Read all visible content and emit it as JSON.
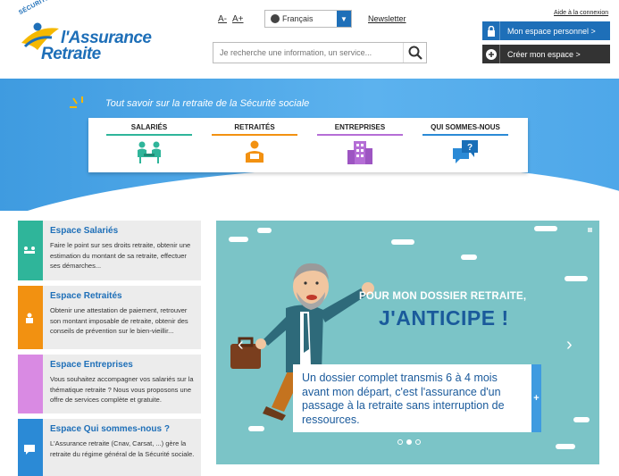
{
  "header": {
    "logo_top": "SÉCURITÉ SOCIALE",
    "logo_line1": "l'Assurance",
    "logo_line2": "Retraite",
    "font_smaller": "A-",
    "font_larger": "A+",
    "language": "Français",
    "newsletter": "Newsletter",
    "search_placeholder": "Je recherche une information, un service...",
    "help_login": "Aide à la connexion",
    "personal_space": "Mon espace personnel >",
    "create_space": "Créer mon espace >"
  },
  "banner": {
    "tagline": "Tout savoir sur la retraite de la Sécurité sociale",
    "categories": [
      {
        "label": "SALARIÉS",
        "color": "#2fb59a",
        "icon": "people-icon"
      },
      {
        "label": "RETRAITÉS",
        "color": "#f29111",
        "icon": "retiree-icon"
      },
      {
        "label": "ENTREPRISES",
        "color": "#b56ed6",
        "icon": "building-icon"
      },
      {
        "label": "QUI SOMMES-NOUS",
        "color": "#2b8ad6",
        "icon": "speech-bubble-icon"
      }
    ]
  },
  "espaces": [
    {
      "title": "Espace Salariés",
      "desc": "Faire le point sur ses droits retraite, obtenir une estimation du montant de sa retraite, effectuer ses démarches...",
      "color": "#2fb59a"
    },
    {
      "title": "Espace Retraités",
      "desc": "Obtenir une attestation de paiement, retrouver son montant imposable de retraite, obtenir des conseils de prévention sur le bien-vieillir...",
      "color": "#f29111"
    },
    {
      "title": "Espace Entreprises",
      "desc": "Vous souhaitez accompagner vos salariés sur la thématique retraite ? Nous vous proposons une offre de services complète et gratuite.",
      "color": "#d98ae3"
    },
    {
      "title": "Espace Qui sommes-nous ?",
      "desc": "L'Assurance retraite (Cnav, Carsat, ...) gère la retraite du régime général de la Sécurité sociale.",
      "color": "#2b8ad6"
    }
  ],
  "carousel": {
    "headline1": "POUR MON DOSSIER RETRAITE,",
    "headline2": "J'ANTICIPE !",
    "text": "Un dossier complet transmis 6 à 4 mois avant mon départ, c'est l'assurance d'un passage à la retraite sans interruption de ressources.",
    "plus": "+",
    "prev": "‹",
    "next": "›"
  }
}
